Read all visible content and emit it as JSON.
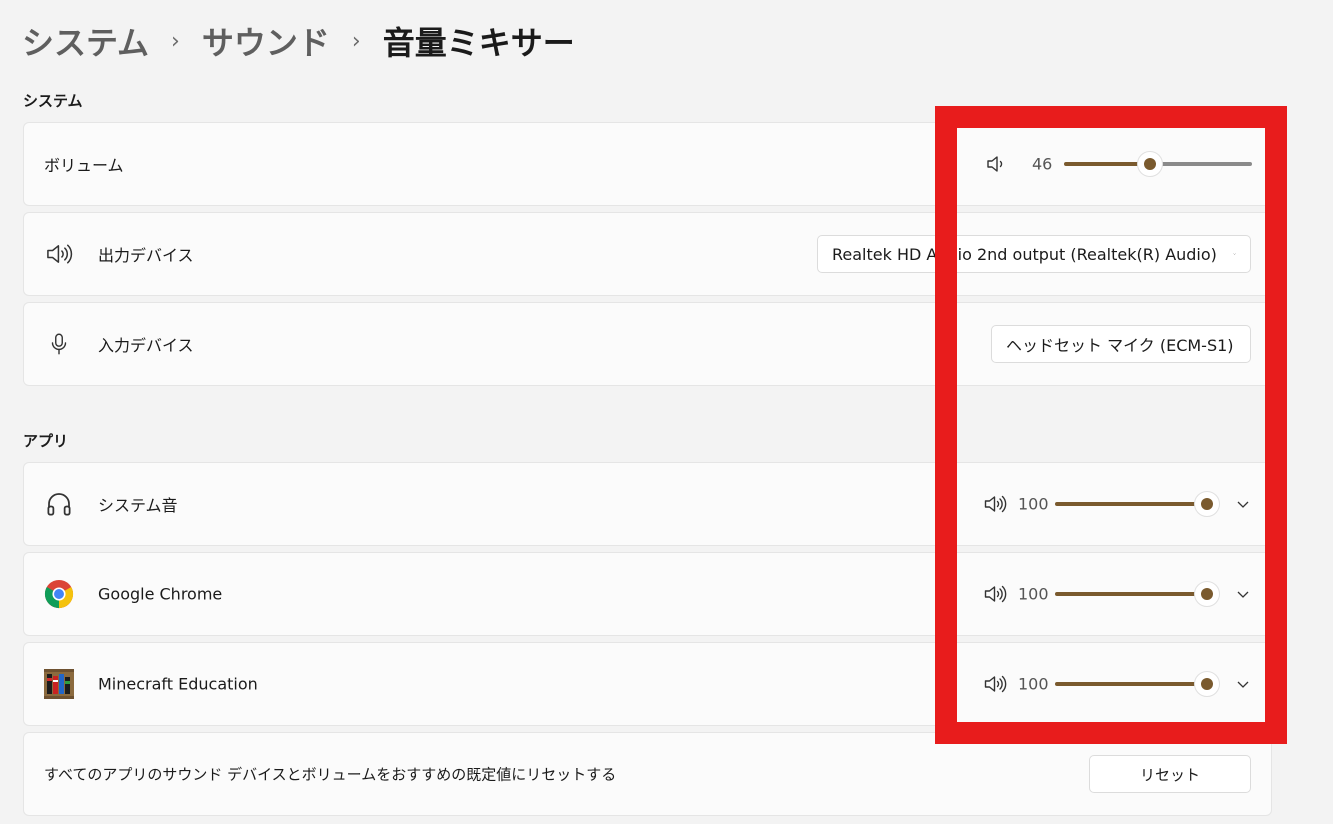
{
  "breadcrumb": {
    "items": [
      "システム",
      "サウンド",
      "音量ミキサー"
    ],
    "separator": "›"
  },
  "system_section": {
    "label": "システム",
    "volume": {
      "label": "ボリューム",
      "value": "46",
      "level": 46
    },
    "output": {
      "label": "出力デバイス",
      "selected": "Realtek HD Audio 2nd output (Realtek(R) Audio)"
    },
    "input": {
      "label": "入力デバイス",
      "selected": "ヘッドセット マイク (ECM-S1)"
    }
  },
  "apps_section": {
    "label": "アプリ",
    "apps": [
      {
        "name": "システム音",
        "icon": "headphones-icon",
        "value": "100",
        "level": 100
      },
      {
        "name": "Google Chrome",
        "icon": "chrome-icon",
        "value": "100",
        "level": 100
      },
      {
        "name": "Minecraft Education",
        "icon": "minecraft-education-icon",
        "value": "100",
        "level": 100
      }
    ]
  },
  "reset": {
    "label": "すべてのアプリのサウンド デバイスとボリュームをおすすめの既定値にリセットする",
    "button": "リセット"
  },
  "colors": {
    "accent": "#7a5a2e",
    "highlight": "#e81c1c",
    "card_bg": "#fbfbfb",
    "page_bg": "#f3f3f3"
  }
}
